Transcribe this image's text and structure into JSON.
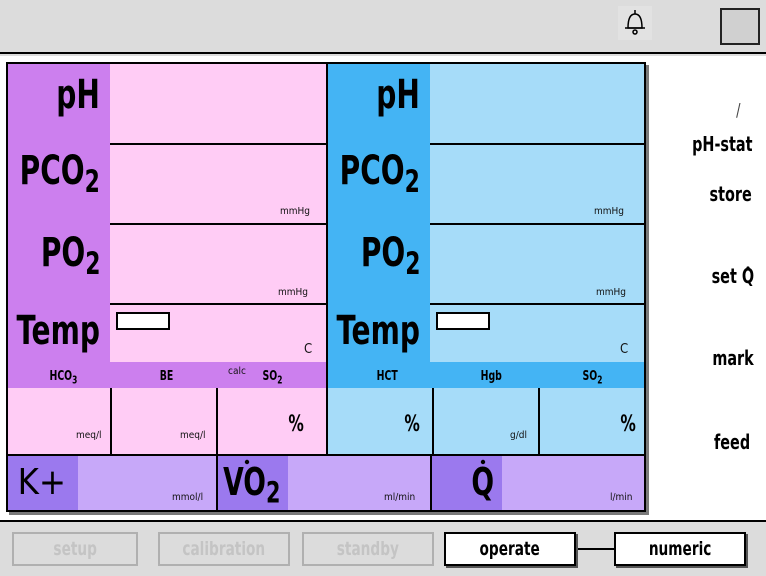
{
  "colors": {
    "left_label_bg": "#cc7fee",
    "left_value_bg": "#ffccf5",
    "right_label_bg": "#44b4f4",
    "right_value_bg": "#a6dcf9",
    "lower_label_bg": "#9b79ee",
    "lower_value_bg": "#c7a8f9"
  },
  "left_panel": {
    "ph_label": "pH",
    "pco2_label": "PCO",
    "pco2_sub": "2",
    "pco2_unit": "mmHg",
    "po2_label": "PO",
    "po2_sub": "2",
    "po2_unit": "mmHg",
    "temp_label": "Temp",
    "temp_unit": "C",
    "hco3_label": "HCO",
    "hco3_sub": "3",
    "be_label": "BE",
    "calc_label": "calc",
    "so2_label": "SO",
    "so2_sub": "2",
    "hco3_unit": "meq/l",
    "be_unit": "meq/l",
    "so2_unit": "%"
  },
  "right_panel": {
    "ph_label": "pH",
    "pco2_label": "PCO",
    "pco2_sub": "2",
    "pco2_unit": "mmHg",
    "po2_label": "PO",
    "po2_sub": "2",
    "po2_unit": "mmHg",
    "temp_label": "Temp",
    "temp_unit": "C",
    "hct_label": "HCT",
    "hgb_label": "Hgb",
    "so2_label": "SO",
    "so2_sub": "2",
    "hct_unit": "%",
    "hgb_unit": "g/dl",
    "so2_unit": "%"
  },
  "bottom_row": {
    "k_label": "K+",
    "k_unit": "mmol/l",
    "vo2_label": "VO",
    "vo2_sub": "2",
    "vo2_unit": "ml/min",
    "q_label": "Q",
    "q_unit": "l/min"
  },
  "right_menu": {
    "slash": "/",
    "ph_stat": "pH-stat",
    "store": "store",
    "set_q": "set Q",
    "mark": "mark",
    "feed": "feed"
  },
  "mode_buttons": {
    "setup": "setup",
    "calibration": "calibration",
    "standby": "standby",
    "operate": "operate",
    "numeric": "numeric"
  },
  "icons": {
    "bell": "bell-icon"
  }
}
